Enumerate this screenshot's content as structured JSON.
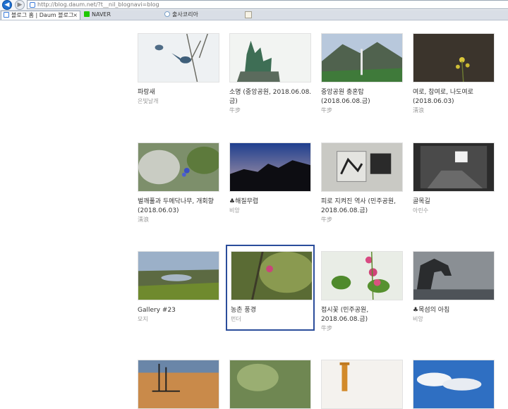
{
  "browser": {
    "url": "http://blog.daum.net/?t__nil_blognavi=blog",
    "tabs": [
      {
        "title": "블로그 홈 | Daum 블로그",
        "active": true
      },
      {
        "title": "NAVER",
        "active": false
      },
      {
        "title": "출사코리아",
        "active": false
      }
    ],
    "close_glyph": "×"
  },
  "gallery": [
    {
      "title": "파랑새",
      "author": "은빛날개"
    },
    {
      "title": "소명 (중앙공원, 2018.06.08.금)",
      "author": "牛步"
    },
    {
      "title": "중앙공원 충혼탑 (2018.06.08.금)",
      "author": "牛步"
    },
    {
      "title": "여로, 참여로, 나도여로 (2018.06.03)",
      "author": "淸浪"
    },
    {
      "title": "벌깨풀과 두메닥나무, 개회향 (2018.06.03)",
      "author": "淸浪"
    },
    {
      "title": "♣해질무렵",
      "author": "비앙"
    },
    {
      "title": "피로 지켜진 역사 (민주공원, 2018.06.08.금)",
      "author": "牛步"
    },
    {
      "title": "골목길",
      "author": "아린수"
    },
    {
      "title": "Gallery #23",
      "author": "모지"
    },
    {
      "title": "농촌 풍경",
      "author": "펀더"
    },
    {
      "title": "접시꽃 (민주공원, 2018.06.08.금)",
      "author": "牛步"
    },
    {
      "title": "♣목섬의 아침",
      "author": "비앙"
    }
  ]
}
